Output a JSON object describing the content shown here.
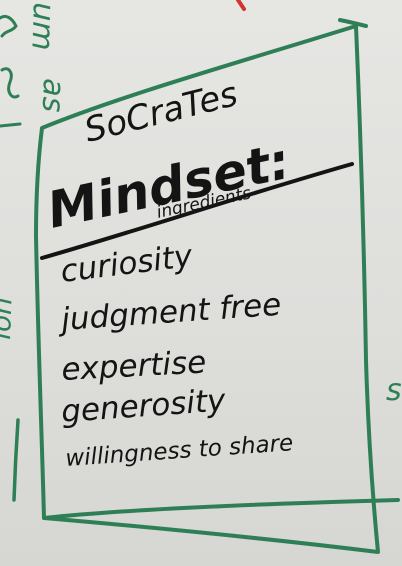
{
  "whiteboard": {
    "heading_line1": "SoCraTes",
    "heading_line2": "Mindset:",
    "subheading": "ingredients",
    "items": [
      "curiosity",
      "judgment free",
      "expertise",
      "generosity",
      "willingness to share"
    ],
    "margin_fragments": [
      "as",
      "um",
      "ion",
      "s"
    ],
    "colors": {
      "board": "#e3e3e0",
      "ink_black": "#141414",
      "ink_green": "#2f7f56",
      "ink_red": "#d2342f"
    }
  }
}
